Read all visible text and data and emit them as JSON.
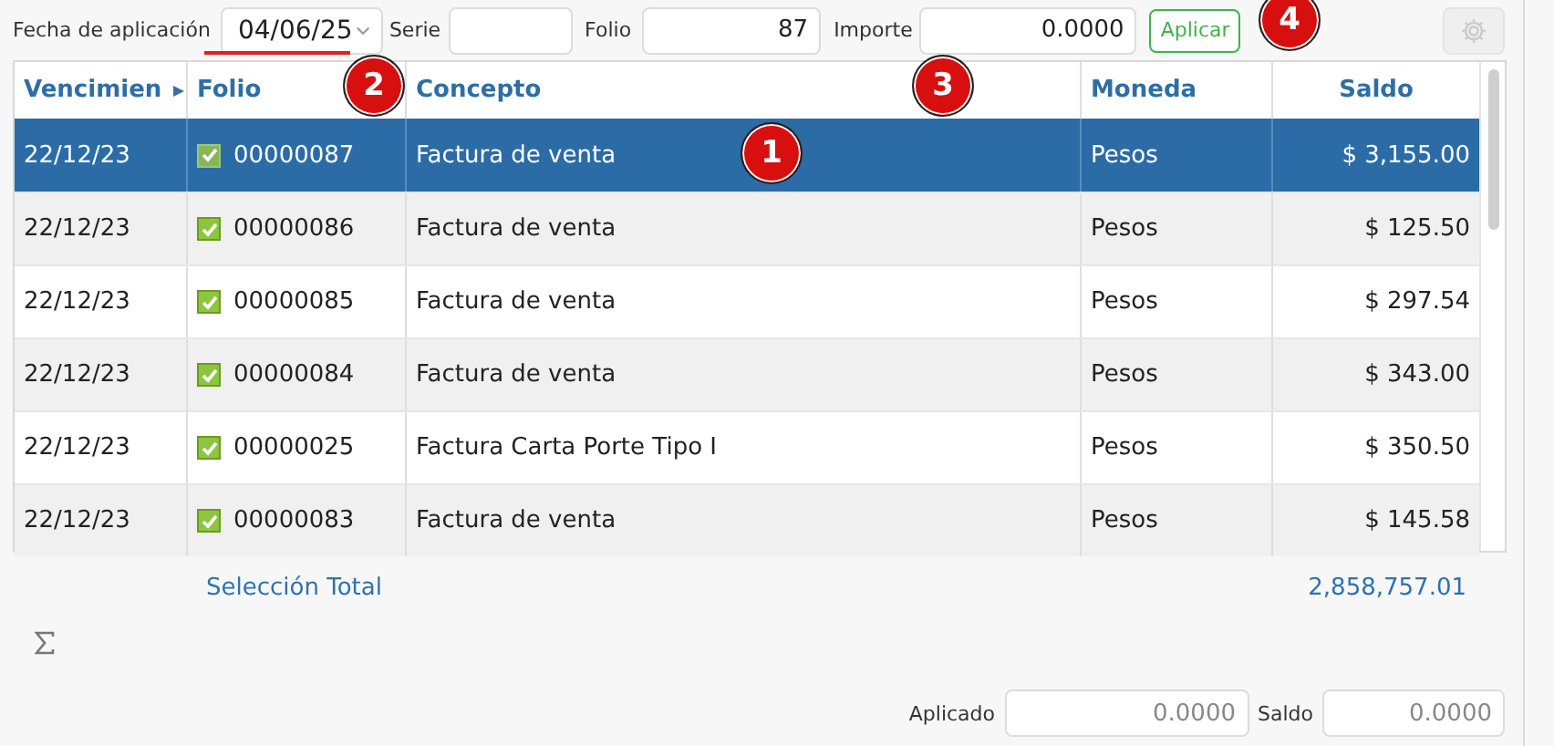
{
  "toolbar": {
    "date_label": "Fecha de aplicación",
    "date_value": "04/06/25",
    "serie_label": "Serie",
    "folio_label": "Folio",
    "folio_value": "87",
    "importe_label": "Importe",
    "importe_value": "0.0000",
    "apply_button": "Aplicar",
    "settings_disabled": true
  },
  "table": {
    "columns": [
      "Vencimien",
      "Folio",
      "Concepto",
      "Moneda",
      "Saldo"
    ],
    "rows": [
      {
        "vencimiento": "22/12/23",
        "folio": "00000087",
        "concepto": "Factura de venta",
        "moneda": "Pesos",
        "saldo": "$ 3,155.00",
        "checked": true,
        "selected": true
      },
      {
        "vencimiento": "22/12/23",
        "folio": "00000086",
        "concepto": "Factura de venta",
        "moneda": "Pesos",
        "saldo": "$ 125.50",
        "checked": true,
        "selected": false
      },
      {
        "vencimiento": "22/12/23",
        "folio": "00000085",
        "concepto": "Factura de venta",
        "moneda": "Pesos",
        "saldo": "$ 297.54",
        "checked": true,
        "selected": false
      },
      {
        "vencimiento": "22/12/23",
        "folio": "00000084",
        "concepto": "Factura de venta",
        "moneda": "Pesos",
        "saldo": "$ 343.00",
        "checked": true,
        "selected": false
      },
      {
        "vencimiento": "22/12/23",
        "folio": "00000025",
        "concepto": "Factura Carta Porte Tipo I",
        "moneda": "Pesos",
        "saldo": "$ 350.50",
        "checked": true,
        "selected": false
      },
      {
        "vencimiento": "22/12/23",
        "folio": "00000083",
        "concepto": "Factura de venta",
        "moneda": "Pesos",
        "saldo": "$ 145.58",
        "checked": true,
        "selected": false
      }
    ]
  },
  "summary": {
    "label": "Selección Total",
    "total": "2,858,757.01"
  },
  "footer": {
    "aplicado_label": "Aplicado",
    "aplicado_value": "0.0000",
    "saldo_label": "Saldo",
    "saldo_value": "0.0000"
  },
  "annotations": [
    {
      "label": "1"
    },
    {
      "label": "2"
    },
    {
      "label": "3"
    },
    {
      "label": "4"
    }
  ]
}
